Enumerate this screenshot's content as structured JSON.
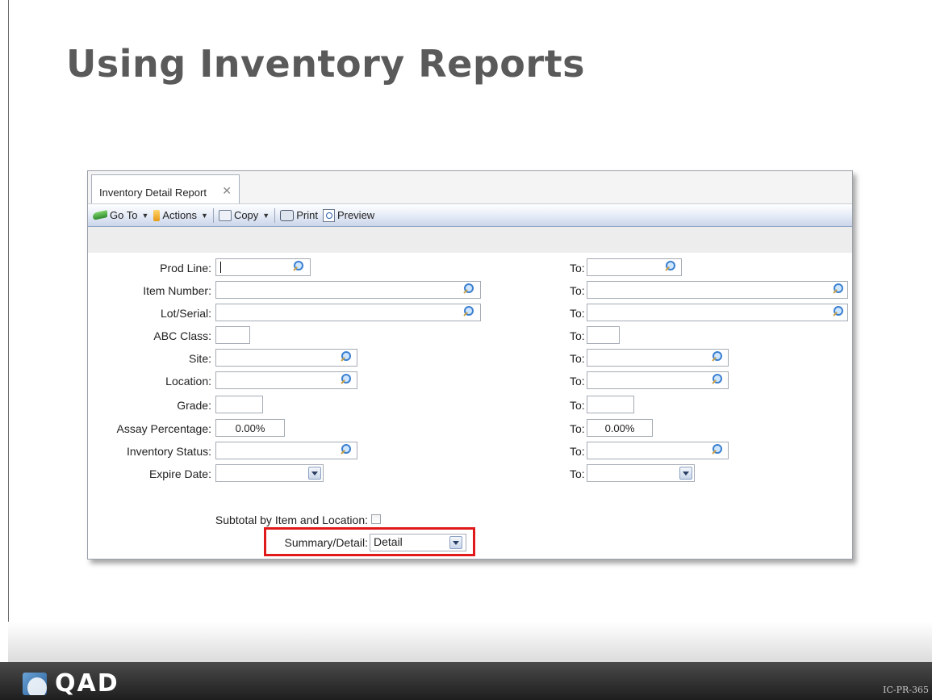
{
  "slide": {
    "title": "Using Inventory Reports",
    "logo_text": "QAD",
    "code": "IC-PR-365"
  },
  "window": {
    "tab_label": "Inventory Detail Report",
    "tab_close": "✕",
    "toolbar": {
      "goto": "Go To",
      "actions": "Actions",
      "copy": "Copy",
      "print": "Print",
      "preview": "Preview"
    }
  },
  "form": {
    "to_label": "To:",
    "fields": {
      "prod_line": {
        "label": "Prod Line:",
        "value": "",
        "to_value": ""
      },
      "item_number": {
        "label": "Item Number:",
        "value": "",
        "to_value": ""
      },
      "lot_serial": {
        "label": "Lot/Serial:",
        "value": "",
        "to_value": ""
      },
      "abc_class": {
        "label": "ABC Class:",
        "value": "",
        "to_value": ""
      },
      "site": {
        "label": "Site:",
        "value": "",
        "to_value": ""
      },
      "location": {
        "label": "Location:",
        "value": "",
        "to_value": ""
      },
      "grade": {
        "label": "Grade:",
        "value": "",
        "to_value": ""
      },
      "assay": {
        "label": "Assay Percentage:",
        "value": "0.00%",
        "to_value": "0.00%"
      },
      "inventory_status": {
        "label": "Inventory Status:",
        "value": "",
        "to_value": ""
      },
      "expire_date": {
        "label": "Expire Date:",
        "value": "",
        "to_value": ""
      }
    },
    "subtotal_label": "Subtotal by Item and Location:",
    "subtotal_checked": false,
    "summary_label": "Summary/Detail:",
    "summary_value": "Detail"
  },
  "colors": {
    "highlight": "#e01a1a",
    "accent": "#3a7fcf"
  }
}
